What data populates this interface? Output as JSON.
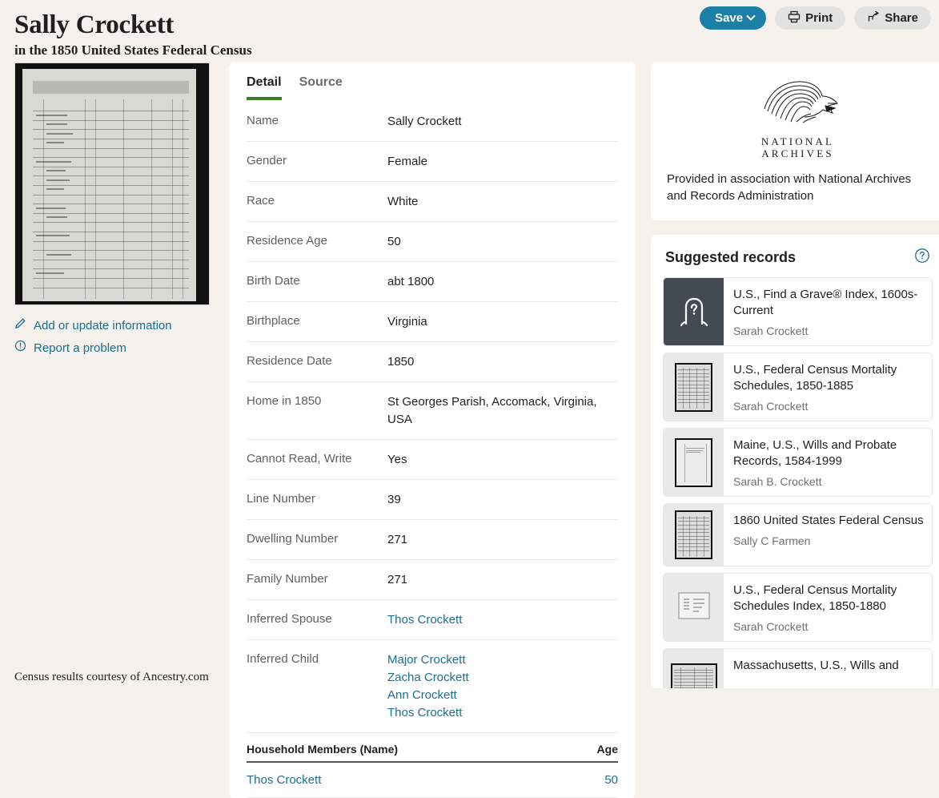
{
  "header": {
    "title": "Sally Crockett",
    "subtitle": "in the 1850 United States Federal Census",
    "save_label": "Save",
    "print_label": "Print",
    "share_label": "Share"
  },
  "left": {
    "add_update_label": "Add or update information",
    "report_problem_label": "Report a problem"
  },
  "tabs": [
    {
      "label": "Detail",
      "active": true
    },
    {
      "label": "Source",
      "active": false
    }
  ],
  "detail_rows": [
    {
      "label": "Name",
      "value": "Sally Crockett",
      "link": false
    },
    {
      "label": "Gender",
      "value": "Female",
      "link": false
    },
    {
      "label": "Race",
      "value": "White",
      "link": false
    },
    {
      "label": "Residence Age",
      "value": "50",
      "link": false
    },
    {
      "label": "Birth Date",
      "value": "abt 1800",
      "link": false
    },
    {
      "label": "Birthplace",
      "value": "Virginia",
      "link": false
    },
    {
      "label": "Residence Date",
      "value": "1850",
      "link": false
    },
    {
      "label": "Home in 1850",
      "value": "St Georges Parish, Accomack, Virginia, USA",
      "link": false
    },
    {
      "label": "Cannot Read, Write",
      "value": "Yes",
      "link": false
    },
    {
      "label": "Line Number",
      "value": "39",
      "link": false
    },
    {
      "label": "Dwelling Number",
      "value": "271",
      "link": false
    },
    {
      "label": "Family Number",
      "value": "271",
      "link": false
    },
    {
      "label": "Inferred Spouse",
      "values": [
        "Thos Crockett"
      ],
      "link": true
    },
    {
      "label": "Inferred Child",
      "values": [
        "Major Crockett",
        "Zacha Crockett",
        "Ann Crockett",
        "Thos Crockett"
      ],
      "link": true
    }
  ],
  "household": {
    "col_name": "Household Members (Name)",
    "col_age": "Age",
    "rows": [
      {
        "name": "Thos Crockett",
        "age": "50"
      }
    ]
  },
  "archives": {
    "logo_line1": "NATIONAL",
    "logo_line2": "ARCHIVES",
    "caption": "Provided in association with National Archives and Records Administration"
  },
  "suggested": {
    "title": "Suggested records",
    "items": [
      {
        "name": "U.S., Find a Grave® Index, 1600s-Current",
        "person": "Sarah Crockett",
        "thumb": "grave-icon"
      },
      {
        "name": "U.S., Federal Census Mortality Schedules, 1850-1885",
        "person": "Sarah Crockett",
        "thumb": "document-scan"
      },
      {
        "name": "Maine, U.S., Wills and Probate Records, 1584-1999",
        "person": "Sarah B. Crockett",
        "thumb": "document-page"
      },
      {
        "name": "1860 United States Federal Census",
        "person": "Sally C Farmen",
        "thumb": "document-scan"
      },
      {
        "name": "U.S., Federal Census Mortality Schedules Index, 1850-1880",
        "person": "Sarah Crockett",
        "thumb": "index-card"
      },
      {
        "name": "Massachusetts, U.S., Wills and",
        "person": "",
        "thumb": "document-book"
      }
    ]
  },
  "footer": {
    "text": "Census results courtesy of Ancestry.com"
  },
  "colors": {
    "accent_link": "#1b6e91",
    "save_button": "#1b7fa8",
    "tab_underline": "#3a8023",
    "page_background": "#f5f2ee"
  }
}
